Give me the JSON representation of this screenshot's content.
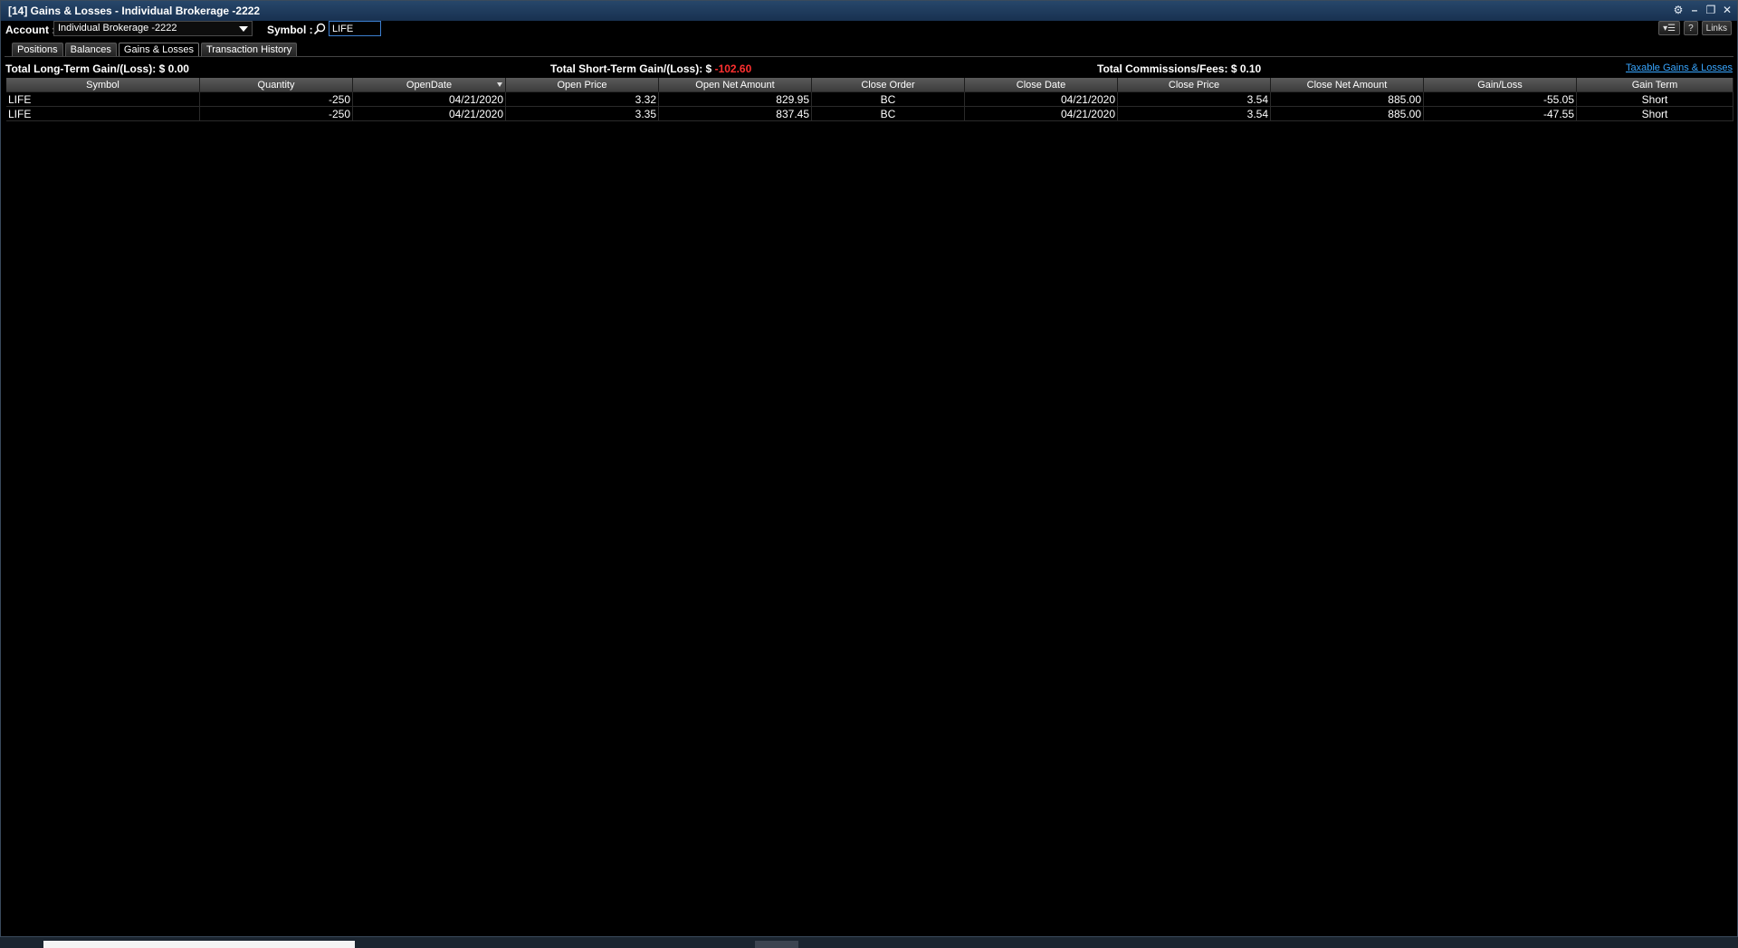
{
  "window": {
    "title": "[14] Gains & Losses - Individual Brokerage -2222"
  },
  "toolbar": {
    "account_label": "Account :",
    "account_value": "Individual Brokerage -2222",
    "symbol_label": "Symbol :",
    "symbol_value": "LIFE",
    "links_label": "Links",
    "help_label": "?"
  },
  "tabs": [
    {
      "label": "Positions"
    },
    {
      "label": "Balances"
    },
    {
      "label": "Gains & Losses"
    },
    {
      "label": "Transaction History"
    }
  ],
  "summary": {
    "long_term_label": "Total Long-Term Gain/(Loss):",
    "long_term_value": "$ 0.00",
    "short_term_label": "Total Short-Term Gain/(Loss): $",
    "short_term_value": "-102.60",
    "commissions_label": "Total Commissions/Fees:",
    "commissions_value": "$ 0.10",
    "taxable_link": "Taxable Gains & Losses"
  },
  "columns": [
    "Symbol",
    "Quantity",
    "OpenDate",
    "Open Price",
    "Open Net Amount",
    "Close Order",
    "Close Date",
    "Close Price",
    "Close Net Amount",
    "Gain/Loss",
    "Gain Term"
  ],
  "rows": [
    {
      "symbol": "LIFE",
      "quantity": "-250",
      "open_date": "04/21/2020",
      "open_price": "3.32",
      "open_net": "829.95",
      "close_order": "BC",
      "close_date": "04/21/2020",
      "close_price": "3.54",
      "close_net": "885.00",
      "gain_loss": "-55.05",
      "gain_term": "Short"
    },
    {
      "symbol": "LIFE",
      "quantity": "-250",
      "open_date": "04/21/2020",
      "open_price": "3.35",
      "open_net": "837.45",
      "close_order": "BC",
      "close_date": "04/21/2020",
      "close_price": "3.54",
      "close_net": "885.00",
      "gain_loss": "-47.55",
      "gain_term": "Short"
    }
  ],
  "colors": {
    "negative": "#ff3030",
    "link": "#38a6ff",
    "title_bar": "#183150"
  }
}
